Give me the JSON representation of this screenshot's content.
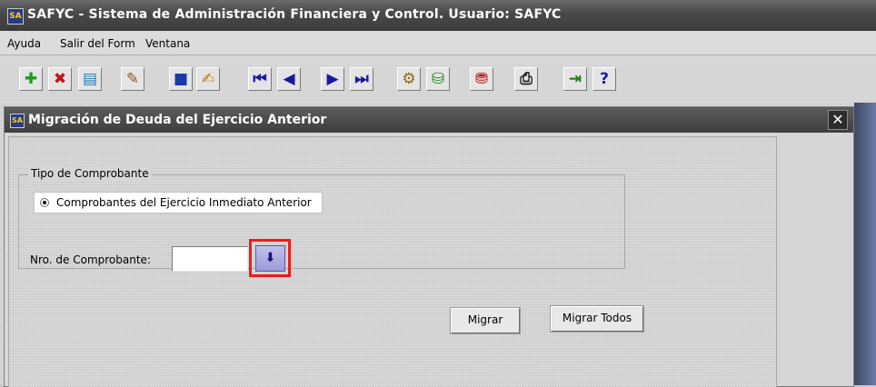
{
  "app": {
    "title": "SAFYC - Sistema de Administración Financiera y Control. Usuario: SAFYC",
    "icon": "app-logo-icon"
  },
  "menu": [
    "Ayuda",
    "Salir del Form",
    "Ventana"
  ],
  "toolbar": {
    "buttons": [
      {
        "icon": "insert-record-icon",
        "glyph": "✚",
        "color": "#1a9a1a"
      },
      {
        "icon": "delete-record-icon",
        "glyph": "✖",
        "color": "#c01818"
      },
      {
        "icon": "duplicate-record-icon",
        "glyph": "▤",
        "color": "#1a7ab8"
      },
      {
        "icon": "clear-record-icon",
        "glyph": "✎",
        "color": "#8a5a20"
      },
      {
        "icon": "save-icon",
        "glyph": "■",
        "color": "#1a3aa8"
      },
      {
        "icon": "edit-icon",
        "glyph": "✍",
        "color": "#b87a10"
      },
      {
        "icon": "first-record-icon",
        "glyph": "⏮",
        "color": "#1a1aa0"
      },
      {
        "icon": "previous-record-icon",
        "glyph": "◀",
        "color": "#1a1aa0"
      },
      {
        "icon": "next-record-icon",
        "glyph": "▶",
        "color": "#1a1aa0"
      },
      {
        "icon": "last-record-icon",
        "glyph": "⏭",
        "color": "#1a1aa0"
      },
      {
        "icon": "enter-query-icon",
        "glyph": "⚙",
        "color": "#8a6a10"
      },
      {
        "icon": "execute-query-icon",
        "glyph": "⛁",
        "color": "#208a20"
      },
      {
        "icon": "cancel-query-icon",
        "glyph": "⛃",
        "color": "#b81818"
      },
      {
        "icon": "print-icon",
        "glyph": "⎙",
        "color": "#202020"
      },
      {
        "icon": "exit-icon",
        "glyph": "⇥",
        "color": "#1a7a1a"
      },
      {
        "icon": "help-icon",
        "glyph": "?",
        "color": "#1a1ab0"
      }
    ]
  },
  "form": {
    "title": "Migración de Deuda del Ejercicio Anterior",
    "close_label": "✕",
    "group": {
      "label": "Tipo de Comprobante",
      "radio_label": "Comprobantes del Ejercicio Inmediato Anterior",
      "radio_selected": true,
      "nro_label": "Nro. de Comprobante:",
      "nro_value": "",
      "lov_glyph": "⬇"
    },
    "buttons": {
      "migrar": "Migrar",
      "migrar_todos": "Migrar Todos"
    }
  }
}
